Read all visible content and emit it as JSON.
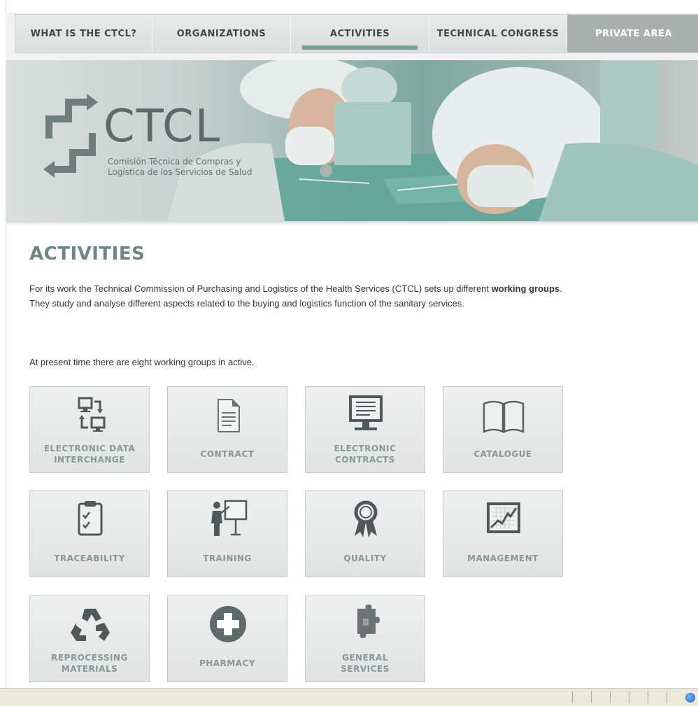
{
  "nav": {
    "items": [
      {
        "label": "WHAT IS THE CTCL?"
      },
      {
        "label": "ORGANIZATIONS"
      },
      {
        "label": "ACTIVITIES",
        "active": true
      },
      {
        "label": "TECHNICAL CONGRESS"
      },
      {
        "label": "PRIVATE AREA"
      }
    ]
  },
  "banner": {
    "logo_text": "CTCL",
    "logo_subtitle_line1": "Comisión Técnica de Compras y",
    "logo_subtitle_line2": "Logística de los Servicios de Salud"
  },
  "content": {
    "title": "ACTIVITIES",
    "intro_part1": "For its work the Technical Commission of Purchasing and Logistics of the Health Services (CTCL) sets up different ",
    "intro_bold": "working groups",
    "intro_part2": ". They study and analyse different aspects related to the buying and logistics function of the sanitary services.",
    "intro2": "At present time there are eight working groups in active."
  },
  "tiles": [
    {
      "label": "ELECTRONIC DATA\nINTERCHANGE",
      "icon": "data-exchange-icon"
    },
    {
      "label": "CONTRACT",
      "icon": "document-icon"
    },
    {
      "label": "ELECTRONIC\nCONTRACTS",
      "icon": "monitor-icon"
    },
    {
      "label": "CATALOGUE",
      "icon": "book-icon"
    },
    {
      "label": "TRACEABILITY",
      "icon": "clipboard-icon"
    },
    {
      "label": "TRAINING",
      "icon": "presentation-icon"
    },
    {
      "label": "QUALITY",
      "icon": "award-icon"
    },
    {
      "label": "MANAGEMENT",
      "icon": "chart-icon"
    },
    {
      "label": "REPROCESSING\nMATERIALS",
      "icon": "recycle-icon"
    },
    {
      "label": "PHARMACY",
      "icon": "plus-icon"
    },
    {
      "label": "GENERAL\nSERVICES",
      "icon": "puzzle-icon"
    }
  ],
  "colors": {
    "accent": "#6e8784",
    "nav_active_bar": "#7e9a94",
    "private_area_bg": "#a9b0ae"
  }
}
